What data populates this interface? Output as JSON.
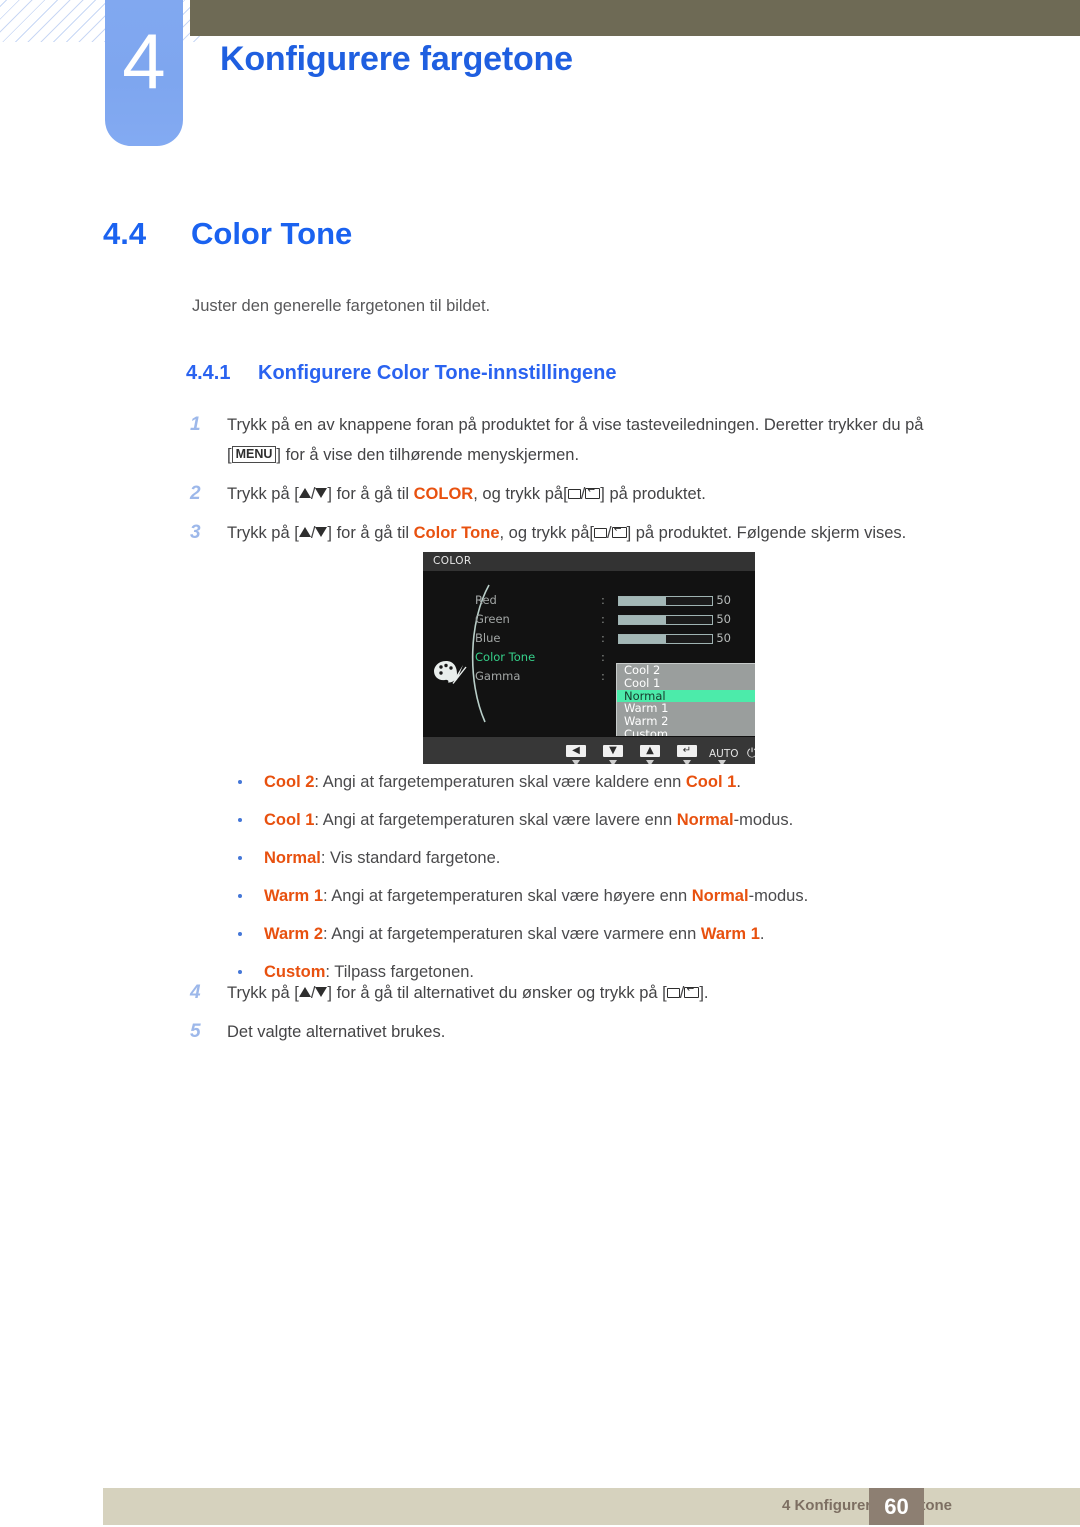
{
  "header": {
    "chapter_number": "4",
    "chapter_title": "Konfigurere fargetone",
    "accent_blue": "#1f5fe0",
    "badge_blue": "#81a8f0",
    "olive": "#6e6a55"
  },
  "section": {
    "number": "4.4",
    "title": "Color Tone",
    "lead": "Juster den generelle fargetonen til bildet.",
    "subsection_number": "4.4.1",
    "subsection_title": "Konfigurere Color Tone-innstillingene"
  },
  "steps": {
    "s1_num": "1",
    "s1_a": "Trykk på en av knappene foran på produktet for å vise tasteveiledningen. Deretter trykker du på",
    "s1_menu": "MENU",
    "s1_b": "for å vise den tilhørende menyskjermen.",
    "s1_bracket_open": "[",
    "s1_bracket_close": "]",
    "s2_num": "2",
    "s2_a": "Trykk på [",
    "s2_slash": "/",
    "s2_b": "] for å gå til ",
    "s2_accent": "COLOR",
    "s2_c": ", og trykk på[",
    "s2_d": "] på produktet.",
    "s3_num": "3",
    "s3_a": "Trykk på [",
    "s3_b": "] for å gå til ",
    "s3_accent": "Color Tone",
    "s3_c": ", og trykk på[",
    "s3_d": "] på produktet. Følgende skjerm vises.",
    "s4_num": "4",
    "s4_a": "Trykk på [",
    "s4_b": "] for å gå til alternativet du ønsker og trykk på [",
    "s4_c": "].",
    "s5_num": "5",
    "s5_text": "Det valgte alternativet brukes."
  },
  "osd": {
    "title": "COLOR",
    "rows": [
      {
        "label": "Red",
        "colon": ":",
        "value": "50",
        "fill_pct": 50
      },
      {
        "label": "Green",
        "colon": ":",
        "value": "50",
        "fill_pct": 50
      },
      {
        "label": "Blue",
        "colon": ":",
        "value": "50",
        "fill_pct": 50
      },
      {
        "label": "Color Tone",
        "colon": ":"
      },
      {
        "label": "Gamma",
        "colon": ":"
      }
    ],
    "dropdown": [
      {
        "label": "Cool 2",
        "selected": false
      },
      {
        "label": "Cool 1",
        "selected": false
      },
      {
        "label": "Normal",
        "selected": true
      },
      {
        "label": "Warm 1",
        "selected": false
      },
      {
        "label": "Warm 2",
        "selected": false
      },
      {
        "label": "Custom",
        "selected": false
      }
    ],
    "footer_buttons": [
      {
        "name": "left-arrow",
        "glyph": "◀"
      },
      {
        "name": "down-arrow",
        "glyph": "▼"
      },
      {
        "name": "up-arrow",
        "glyph": "▲"
      },
      {
        "name": "enter",
        "glyph": "↵"
      },
      {
        "name": "auto",
        "glyph": "AUTO"
      },
      {
        "name": "power",
        "glyph": "⏻"
      }
    ],
    "highlight_color": "#4cebaa",
    "selected_label_color": "#35d08a"
  },
  "bullets": [
    {
      "term": "Cool 2",
      "sep": ": ",
      "text": "Angi at fargetemperaturen skal være kaldere enn ",
      "term2": "Cool 1",
      "tail": "."
    },
    {
      "term": "Cool 1",
      "sep": ": ",
      "text": "Angi at fargetemperaturen skal være lavere enn ",
      "term2": "Normal",
      "tail": "-modus."
    },
    {
      "term": "Normal",
      "sep": ": ",
      "text": "Vis standard fargetone.",
      "term2": "",
      "tail": ""
    },
    {
      "term": "Warm 1",
      "sep": ": ",
      "text": "Angi at fargetemperaturen skal være høyere enn ",
      "term2": "Normal",
      "tail": "-modus."
    },
    {
      "term": "Warm 2",
      "sep": ": ",
      "text": "Angi at fargetemperaturen skal være varmere enn ",
      "term2": "Warm 1",
      "tail": "."
    },
    {
      "term": "Custom",
      "sep": ": ",
      "text": "Tilpass fargetonen.",
      "term2": "",
      "tail": ""
    }
  ],
  "footer": {
    "text": "4 Konfigurere fargetone",
    "page": "60",
    "bar_color": "#d6d2be",
    "page_box_color": "#8d7f72"
  }
}
